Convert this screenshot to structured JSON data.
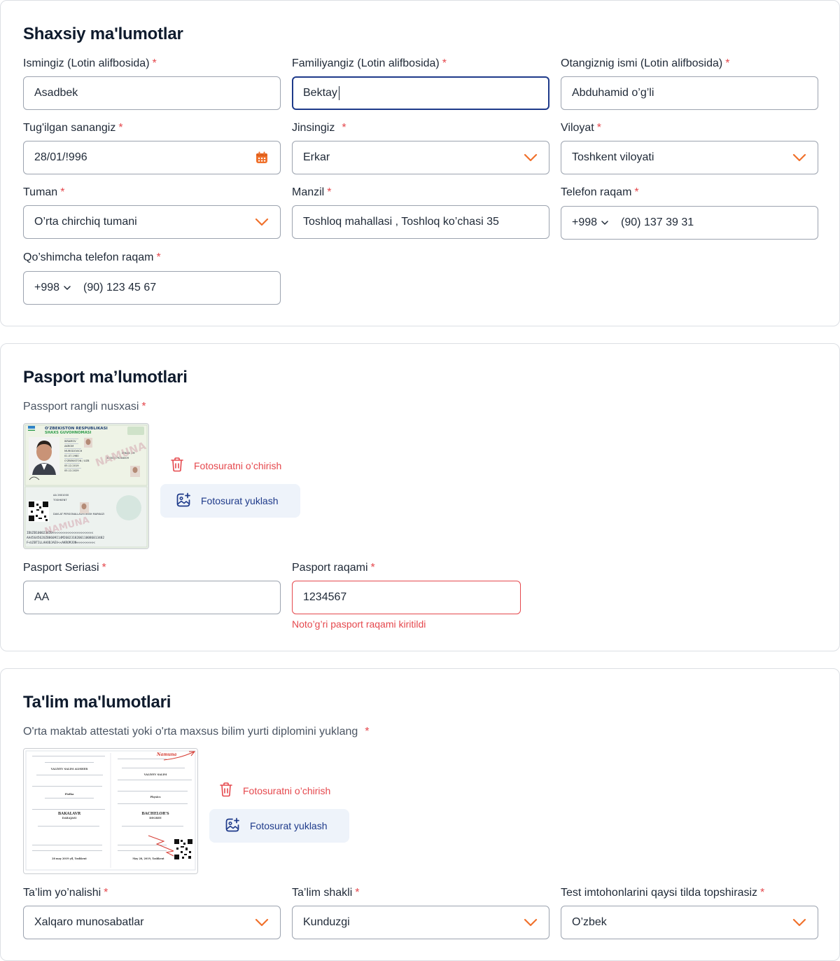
{
  "personal": {
    "title": "Shaxsiy ma'lumotlar",
    "first_name": {
      "label": "Ismingiz (Lotin alifbosida)",
      "value": "Asadbek"
    },
    "last_name": {
      "label": "Familiyangiz (Lotin alifbosida)",
      "value": "Bektay"
    },
    "patronymic": {
      "label": "Otangiznig ismi (Lotin alifbosida)",
      "value": "Abduhamid o’g’li"
    },
    "birth_date": {
      "label": "Tug'ilgan sanangiz",
      "value": "28/01/!996",
      "icon": "calendar-icon"
    },
    "gender": {
      "label": "Jinsingiz",
      "value": "Erkar"
    },
    "region": {
      "label": "Viloyat",
      "value": "Toshkent viloyati"
    },
    "district": {
      "label": "Tuman",
      "value": "O’rta chirchiq tumani"
    },
    "address": {
      "label": "Manzil",
      "value": "Toshloq mahallasi , Toshloq ko’chasi 35"
    },
    "phone": {
      "label": "Telefon raqam",
      "code": "+998",
      "value": "(90) 137 39 31"
    },
    "extra_phone": {
      "label": "Qo’shimcha telefon raqam",
      "code": "+998",
      "value": "(90) 123 45 67"
    },
    "required_mark": "*"
  },
  "passport": {
    "title": "Pasport ma’lumotlari",
    "copy_label": "Passport rangli nusxasi",
    "id_card": {
      "republic": "O'ZBEKISTON RESPUBLIKASI",
      "doc_name": "SHAXS GUVOHNOMASI",
      "watermark": "NAMUNA",
      "surname": "IKRAMOV",
      "given": "AKROM",
      "patronymic": "MURODOVICH",
      "dob": "01.07.1980",
      "nationality": "O'ZBEKISTON / UZB",
      "issue": "05.12.2019",
      "expiry": "05.12.2029",
      "sex": "ERKAK / M",
      "pinfl": "32002279264009",
      "doc_no": "AA 2601000",
      "place": "TOSHKENT",
      "authority": "DAVLAT PERSONALLASHTIRISH MARKAZI",
      "mrz1": "IDUZB1000234IU<<<<<<<<<<<<<<<<<<<<<<",
      "mrz2": "AA4564562UZB8609I14M2602318206110086013482",
      "mrz3": "F<UZBTILLAHODJAEV<<AKROMJON<<<<<<<<<<"
    },
    "delete_label": "Fotosuratni  o’chirish",
    "upload_label": "Fotosurat yuklash",
    "series": {
      "label": "Pasport Seriasi",
      "value": "AA"
    },
    "number": {
      "label": "Pasport  raqami",
      "value": "1234567",
      "error": "Noto’g’ri pasport raqami kiritildi"
    }
  },
  "education": {
    "title": "Ta'lim ma'lumotlari",
    "upload_hint": "O'rta maktab attestati yoki o'rta maxsus bilim yurti diplomini yuklang",
    "diploma": {
      "left_name": "VALIYEV SALIM ALISHER",
      "left_field": "Fizika",
      "left_degree": "BAKALAVR",
      "left_degree2": "DARAJASI",
      "left_date": "28 may 2019 yil, Toshkent",
      "right_stamp": "Namuna",
      "right_name": "VALIYEV SALIM",
      "right_field": "Physics",
      "right_degree": "BACHELOR'S",
      "right_degree2": "DEGREE",
      "right_date": "May 28, 2019, Tashkent"
    },
    "delete_label": "Fotosuratni  o’chirish",
    "upload_label": "Fotosurat yuklash",
    "direction": {
      "label": "Ta’lim yo’nalishi",
      "value": "Xalqaro munosabatlar"
    },
    "form": {
      "label": "Ta’lim shakli",
      "value": "Kunduzgi"
    },
    "exam_lang": {
      "label": "Test imtohonlarini qaysi tilda topshirasiz",
      "value": "O’zbek"
    }
  },
  "colors": {
    "accent": "#f0712c",
    "error": "#e5484d",
    "primary": "#1e3a8a",
    "upload_bg": "#eef3fa"
  }
}
